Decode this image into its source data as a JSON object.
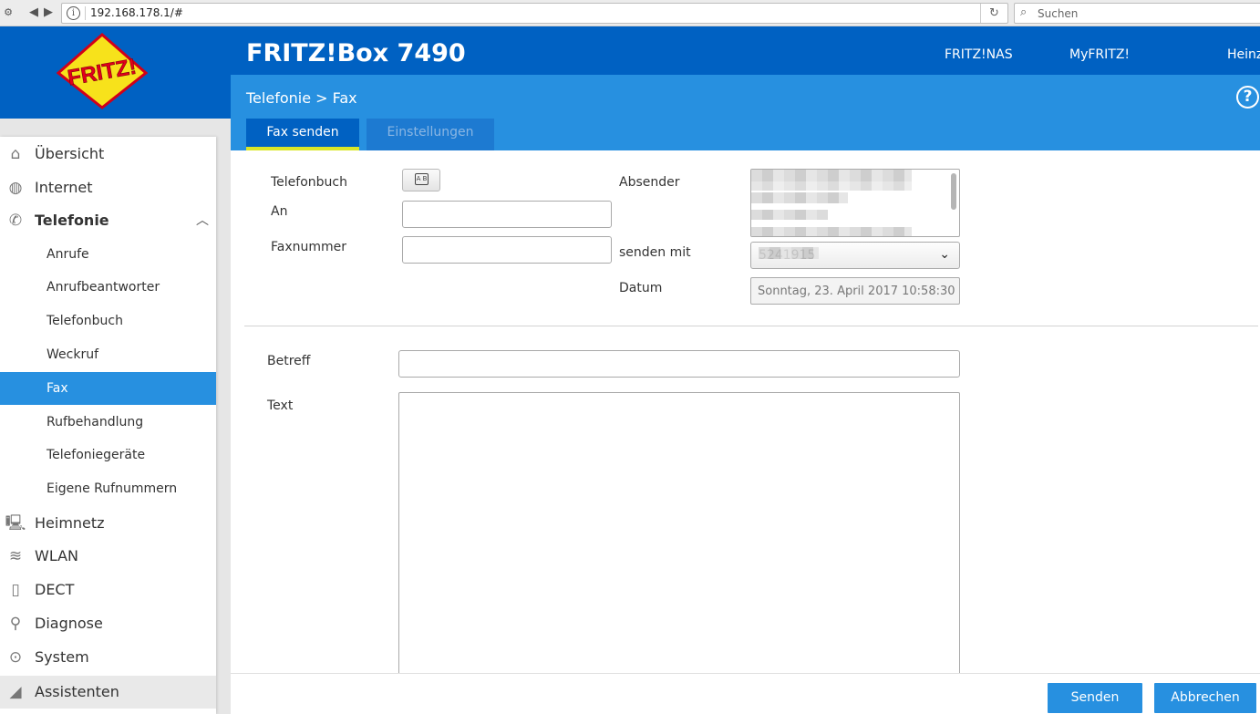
{
  "browser": {
    "url": "192.168.178.1/#",
    "search_placeholder": "Suchen"
  },
  "header": {
    "product": "FRITZ!Box 7490",
    "links": [
      "FRITZ!NAS",
      "MyFRITZ!",
      "Heinz"
    ],
    "logo_text": "FRITZ!"
  },
  "breadcrumb": {
    "parent": "Telefonie",
    "separator": ">",
    "current": "Fax"
  },
  "tabs": [
    {
      "label": "Fax senden",
      "active": true
    },
    {
      "label": "Einstellungen",
      "active": false
    }
  ],
  "sidebar": {
    "items": [
      {
        "label": "Übersicht",
        "icon": "home-icon"
      },
      {
        "label": "Internet",
        "icon": "globe-icon"
      },
      {
        "label": "Telefonie",
        "icon": "phone-icon",
        "open": true
      },
      {
        "label": "Heimnetz",
        "icon": "network-icon"
      },
      {
        "label": "WLAN",
        "icon": "wifi-icon"
      },
      {
        "label": "DECT",
        "icon": "dect-phone-icon"
      },
      {
        "label": "Diagnose",
        "icon": "diagnose-icon"
      },
      {
        "label": "System",
        "icon": "system-icon"
      },
      {
        "label": "Assistenten",
        "icon": "assistant-icon"
      }
    ],
    "telefonie_sub": [
      {
        "label": "Anrufe"
      },
      {
        "label": "Anrufbeantworter"
      },
      {
        "label": "Telefonbuch"
      },
      {
        "label": "Weckruf"
      },
      {
        "label": "Fax",
        "selected": true
      },
      {
        "label": "Rufbehandlung"
      },
      {
        "label": "Telefoniegeräte"
      },
      {
        "label": "Eigene Rufnummern"
      }
    ]
  },
  "form": {
    "telefonbuch_label": "Telefonbuch",
    "an_label": "An",
    "an_value": "",
    "faxnummer_label": "Faxnummer",
    "faxnummer_value": "",
    "absender_label": "Absender",
    "senden_mit_label": "senden mit",
    "senden_mit_value": "5241915",
    "datum_label": "Datum",
    "datum_value": "Sonntag, 23. April 2017 10:58:30",
    "betreff_label": "Betreff",
    "betreff_value": "",
    "text_label": "Text",
    "text_value": ""
  },
  "buttons": {
    "send": "Senden",
    "cancel": "Abbrechen"
  },
  "colors": {
    "header_blue": "#0061c2",
    "accent_blue": "#2790e0",
    "tab_underline": "#d9e628",
    "sidebar_bg": "#e6e6e6"
  }
}
